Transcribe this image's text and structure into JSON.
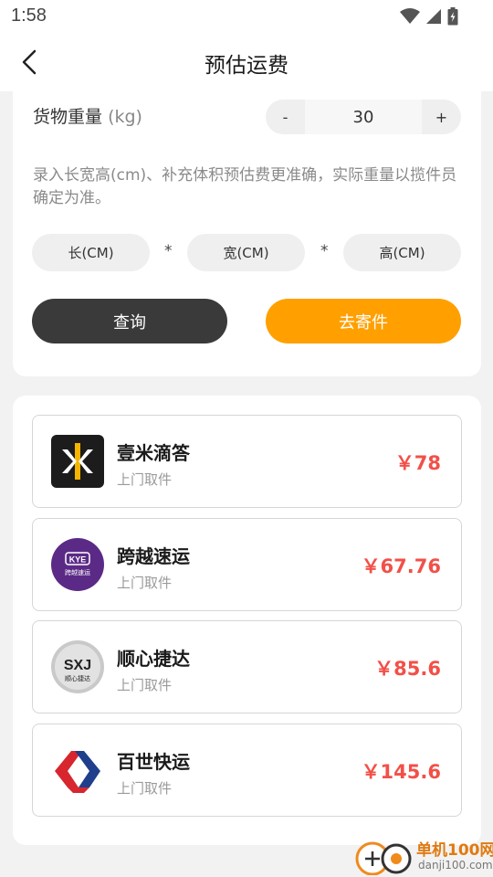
{
  "status": {
    "time": "1:58"
  },
  "header": {
    "title": "预估运费"
  },
  "weight": {
    "label": "货物重量",
    "unit": "(kg)",
    "minus": "-",
    "plus": "+",
    "value": "30"
  },
  "hint": "录入长宽高(cm)、补充体积预估费更准确，实际重量以揽件员确定为准。",
  "dimensions": {
    "length_placeholder": "长(CM)",
    "width_placeholder": "宽(CM)",
    "height_placeholder": "高(CM)",
    "separator": "*"
  },
  "actions": {
    "query": "查询",
    "ship": "去寄件"
  },
  "couriers": [
    {
      "name": "壹米滴答",
      "service": "上门取件",
      "price": "￥78",
      "logo_icon": "yimi-dida-logo"
    },
    {
      "name": "跨越速运",
      "service": "上门取件",
      "price": "￥67.76",
      "logo_icon": "kye-logo",
      "logo_text": "KYE",
      "logo_sub": "跨越速运"
    },
    {
      "name": "顺心捷达",
      "service": "上门取件",
      "price": "￥85.6",
      "logo_icon": "sxjd-logo",
      "logo_text": "SXJ",
      "logo_sub": "顺心捷达"
    },
    {
      "name": "百世快运",
      "service": "上门取件",
      "price": "￥145.6",
      "logo_icon": "best-express-logo"
    }
  ],
  "watermark": {
    "line1": "单机100网",
    "line2": "danji100.com"
  },
  "colors": {
    "accent": "#ffa000",
    "price": "#f25048",
    "dark_button": "#3a3a3a"
  }
}
